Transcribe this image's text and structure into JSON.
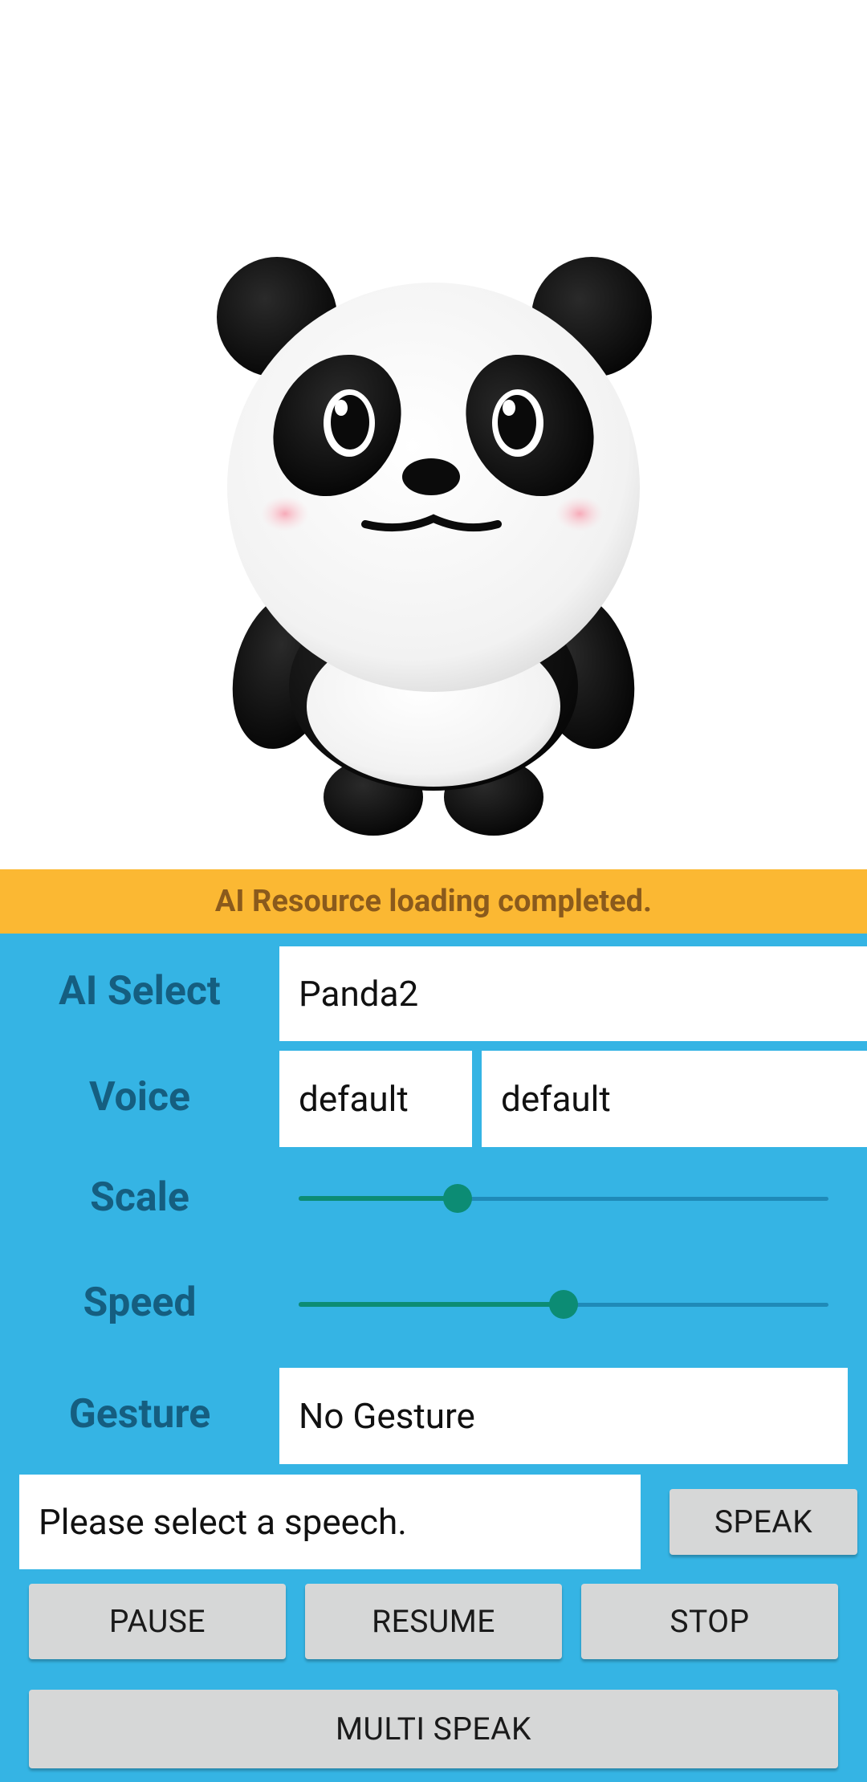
{
  "status": {
    "message": "AI Resource loading completed."
  },
  "ai_select": {
    "label": "AI Select",
    "value": "Panda2"
  },
  "voice": {
    "label": "Voice",
    "value_1": "default",
    "value_2": "default"
  },
  "scale": {
    "label": "Scale",
    "level": 0.3
  },
  "speed": {
    "label": "Speed",
    "level": 0.5
  },
  "gesture": {
    "label": "Gesture",
    "value": "No Gesture"
  },
  "speech": {
    "value": "Please select a speech.",
    "speak_label": "SPEAK"
  },
  "controls": {
    "pause_label": "PAUSE",
    "resume_label": "RESUME",
    "stop_label": "STOP",
    "multi_speak_label": "MULTI SPEAK"
  },
  "colors": {
    "banner": "#fbb833",
    "panel": "#35b4e4",
    "accent": "#0c8c74",
    "label": "#155e80"
  },
  "character": {
    "icon": "panda-character"
  }
}
